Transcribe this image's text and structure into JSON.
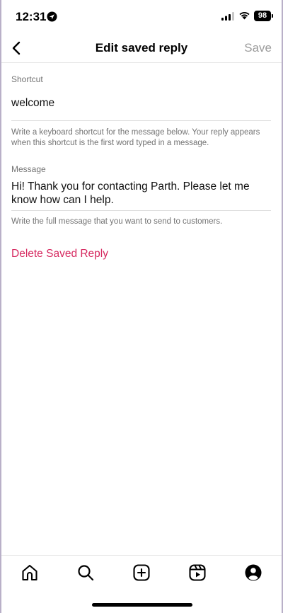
{
  "status_bar": {
    "time": "12:31",
    "battery": "98"
  },
  "header": {
    "title": "Edit saved reply",
    "save_label": "Save"
  },
  "shortcut": {
    "label": "Shortcut",
    "value": "welcome",
    "hint": "Write a keyboard shortcut for the message below. Your reply appears when this shortcut is the first word typed in a message."
  },
  "message": {
    "label": "Message",
    "value": "Hi! Thank you for contacting Parth. Please let me know how can I help.",
    "hint": "Write the full message that you want to send to customers."
  },
  "delete_label": "Delete Saved Reply",
  "tab_bar": {
    "items": [
      "home-icon",
      "search-icon",
      "create-icon",
      "reels-icon",
      "profile-icon"
    ]
  }
}
